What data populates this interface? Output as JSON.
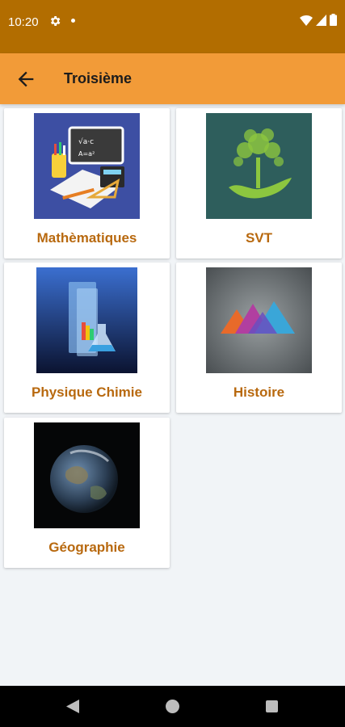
{
  "status": {
    "time": "10:20"
  },
  "app_bar": {
    "title": "Troisième"
  },
  "subjects": [
    {
      "label": "Mathèmatiques"
    },
    {
      "label": "SVT"
    },
    {
      "label": "Physique Chimie"
    },
    {
      "label": "Histoire"
    },
    {
      "label": "Géographie"
    }
  ],
  "colors": {
    "status_bar": "#b26d00",
    "app_bar": "#f29b38",
    "label": "#b8690f",
    "background": "#f1f4f7"
  }
}
